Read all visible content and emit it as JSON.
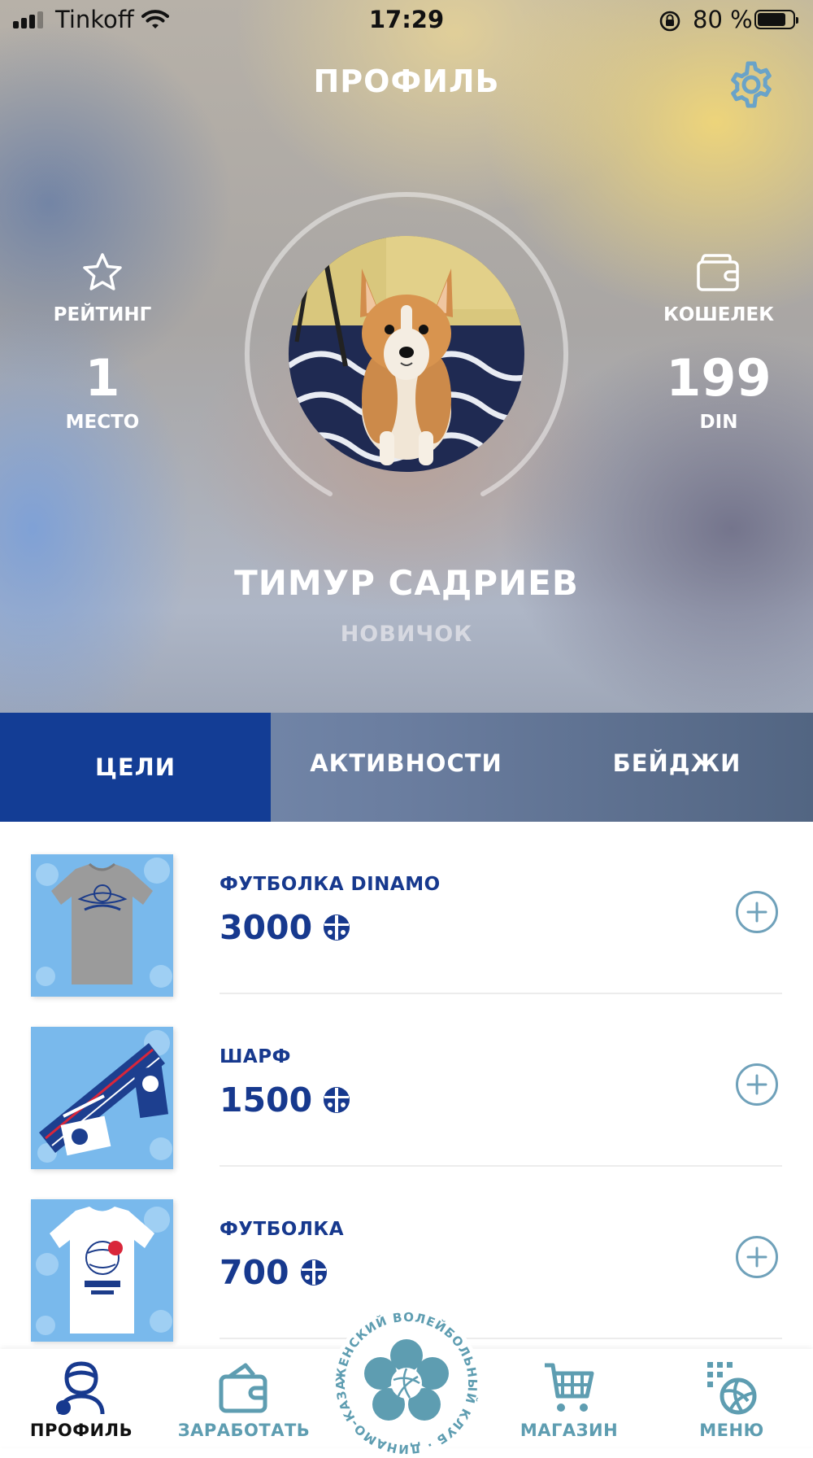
{
  "status_bar": {
    "carrier": "Tinkoff",
    "time": "17:29",
    "battery_percent": "80 %",
    "battery_level": 0.8
  },
  "header": {
    "title": "ПРОФИЛЬ",
    "settings_icon": "gear-icon"
  },
  "rating": {
    "icon": "star-icon",
    "label": "РЕЙТИНГ",
    "value": "1",
    "unit": "МЕСТО"
  },
  "wallet": {
    "icon": "wallet-icon",
    "label": "КОШЕЛЕК",
    "value": "199",
    "unit": "DIN"
  },
  "user": {
    "name": "ТИМУР САДРИЕВ",
    "level": "НОВИЧОК"
  },
  "tabs": [
    {
      "label": "ЦЕЛИ",
      "active": true
    },
    {
      "label": "АКТИВНОСТИ",
      "active": false
    },
    {
      "label": "БЕЙДЖИ",
      "active": false
    }
  ],
  "goals": [
    {
      "title": "ФУТБОЛКА DINAMO",
      "price": "3000",
      "image": "grey-tshirt"
    },
    {
      "title": "ШАРФ",
      "price": "1500",
      "image": "scarf"
    },
    {
      "title": "ФУТБОЛКА",
      "price": "700",
      "image": "white-tshirt"
    }
  ],
  "nav": [
    {
      "label": "ПРОФИЛЬ",
      "icon": "profile-icon",
      "active": true
    },
    {
      "label": "ЗАРАБОТАТЬ",
      "icon": "wallet-icon",
      "active": false
    },
    {
      "label": "МАГАЗИН",
      "icon": "cart-icon",
      "active": false
    },
    {
      "label": "МЕНЮ",
      "icon": "menu-volleyball-icon",
      "active": false
    }
  ],
  "logo_text": "ЖЕНСКИЙ ВОЛЕЙБОЛЬНЫЙ КЛУБ · ДИНАМО-КАЗАНЬ ·",
  "colors": {
    "primary": "#133d95",
    "accent": "#5e9db1",
    "text_dark": "#17398e"
  }
}
